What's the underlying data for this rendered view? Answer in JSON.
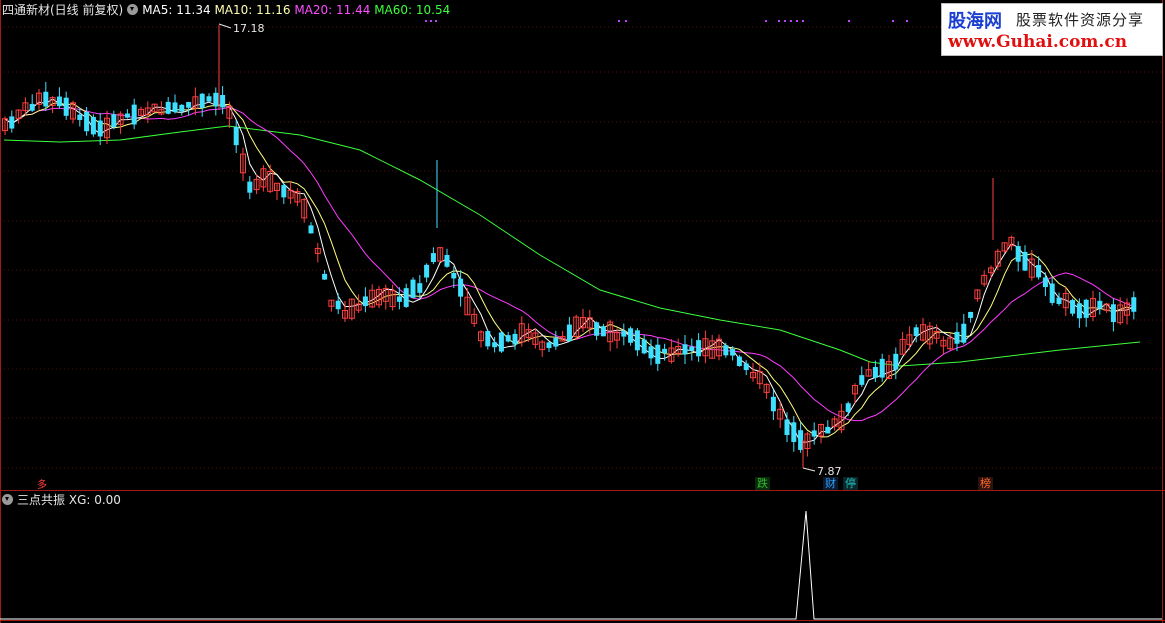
{
  "header": {
    "title": "四通新材(日线 前复权)",
    "ma5": "MA5: 11.34",
    "ma10": "MA10: 11.16",
    "ma20": "MA20: 11.44",
    "ma60": "MA60: 10.54"
  },
  "sub_header": {
    "indicator": "三点共振",
    "value": "XG: 0.00"
  },
  "watermark": {
    "site": "股海网",
    "slogan": "股票软件资源分享",
    "url": "www.Guhai.com.cn"
  },
  "annotations": {
    "high_label": "17.18",
    "low_label": "7.87",
    "left_mark": "多"
  },
  "event_tags": [
    {
      "label": "跌",
      "color": "#2fbf2f"
    },
    {
      "label": "财",
      "color": "#2f9fff"
    },
    {
      "label": "停",
      "color": "#20c0c0"
    },
    {
      "label": "榜",
      "color": "#ff6a30"
    }
  ],
  "colors": {
    "up": "#ff4040",
    "down": "#3fe0ff",
    "ma5": "#ffffff",
    "ma10": "#ffff80",
    "ma20": "#ff3dff",
    "ma60": "#3cff3c",
    "frame": "#a01818",
    "signal_dots": "#c040ff"
  },
  "chart_data": {
    "type": "candlestick",
    "price_high": 17.18,
    "price_low": 7.87,
    "moving_averages": {
      "MA5": 11.34,
      "MA10": 11.16,
      "MA20": 11.44,
      "MA60": 10.54
    },
    "indicator": {
      "name": "三点共振",
      "XG": 0.0
    }
  }
}
